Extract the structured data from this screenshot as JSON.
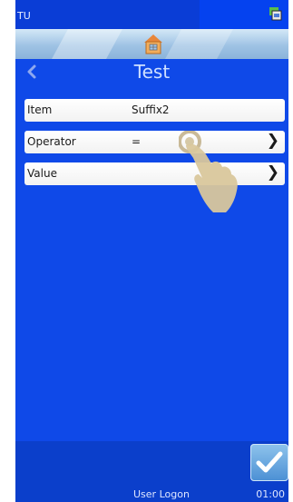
{
  "status_bar": {
    "app_id": "TU",
    "network_icon": "network-icon"
  },
  "header": {
    "home_icon": "home-icon"
  },
  "nav": {
    "back_icon": "chevron-left-icon",
    "title": "Test"
  },
  "rows": [
    {
      "label": "Item",
      "value": "Suffix2",
      "has_chevron": false
    },
    {
      "label": "Operator",
      "value": "=",
      "has_chevron": true
    },
    {
      "label": "Value",
      "value": "",
      "has_chevron": true
    }
  ],
  "overlay": {
    "icon": "hand-pointer-icon"
  },
  "confirm": {
    "icon": "checkmark-icon"
  },
  "footer": {
    "user_logon": "User Logon",
    "clock": "01:00"
  },
  "colors": {
    "screen_background": "#0f49e8",
    "row_background": "#ffffff",
    "title_color": "#cfe0ff",
    "confirm_button": "#5fa2dd"
  }
}
